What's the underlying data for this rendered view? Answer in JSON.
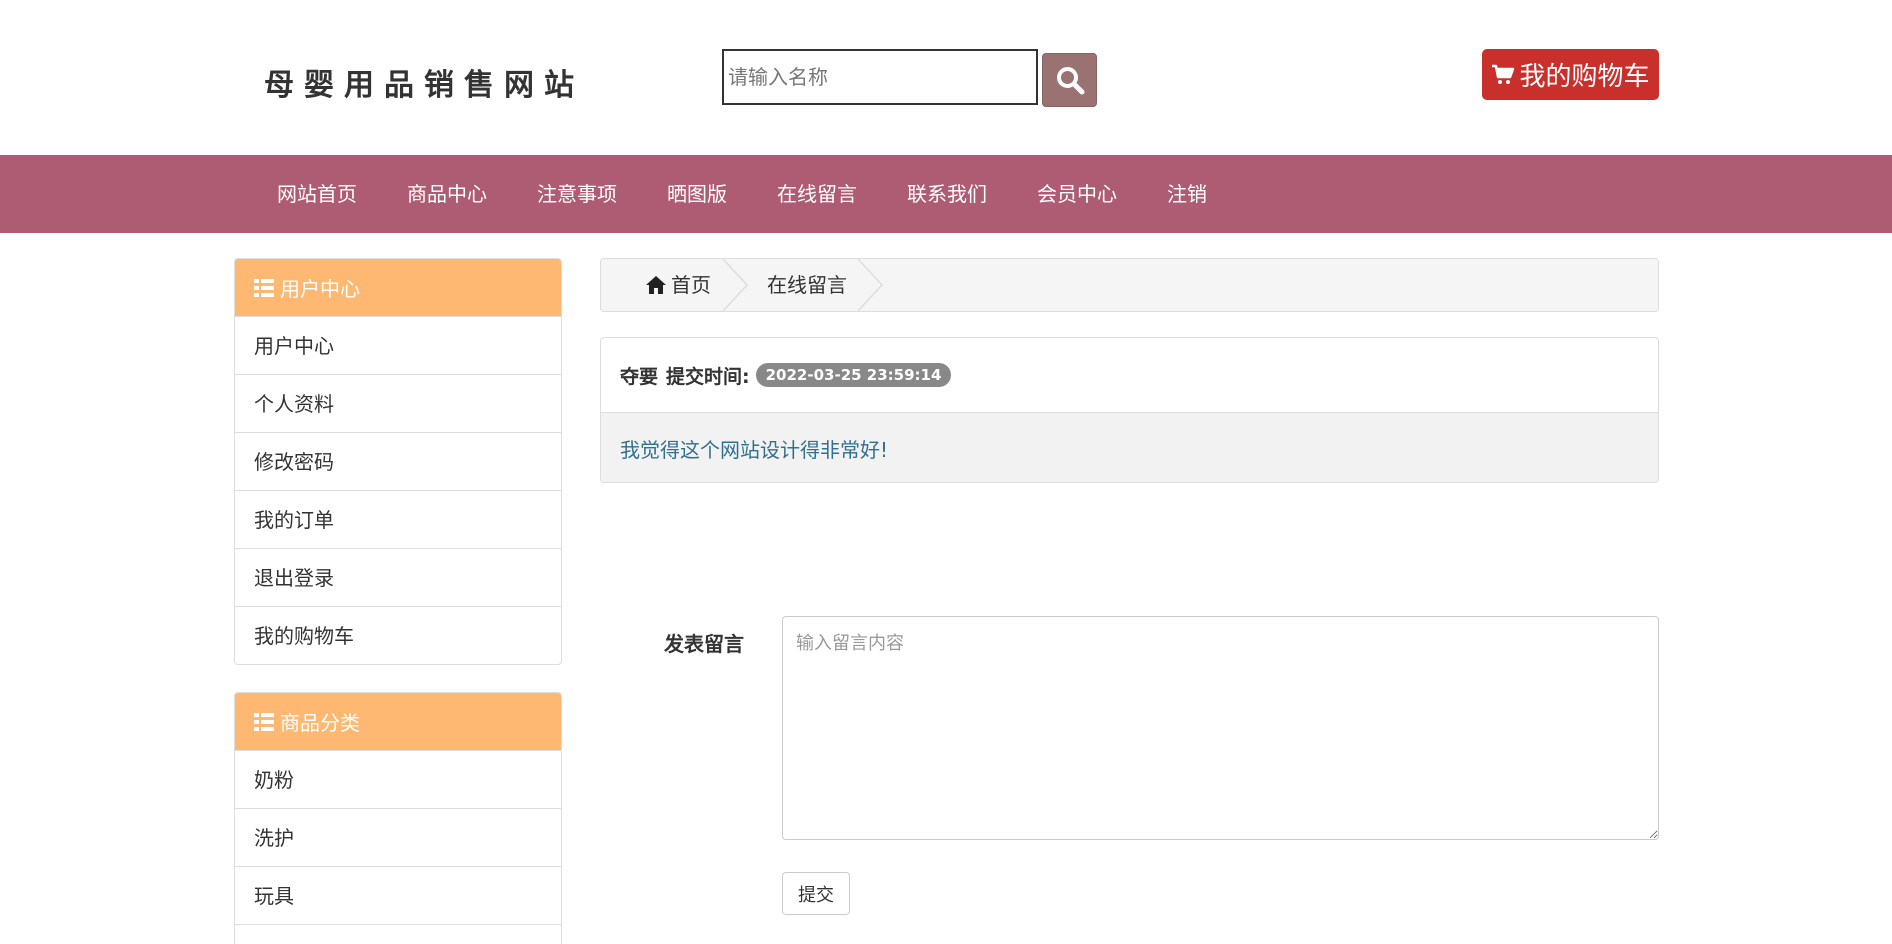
{
  "header": {
    "logo": "母婴用品销售网站",
    "search_placeholder": "请输入名称",
    "search_icon": "search-icon",
    "cart_label": "我的购物车",
    "cart_icon": "shopping-cart-icon"
  },
  "nav": {
    "items": [
      {
        "label": "网站首页"
      },
      {
        "label": "商品中心"
      },
      {
        "label": "注意事项"
      },
      {
        "label": "晒图版"
      },
      {
        "label": "在线留言"
      },
      {
        "label": "联系我们"
      },
      {
        "label": "会员中心"
      },
      {
        "label": "注销"
      }
    ]
  },
  "sidebar": {
    "user_center": {
      "title": "用户中心",
      "icon": "list-icon",
      "items": [
        {
          "label": "用户中心"
        },
        {
          "label": "个人资料"
        },
        {
          "label": "修改密码"
        },
        {
          "label": "我的订单"
        },
        {
          "label": "退出登录"
        },
        {
          "label": "我的购物车"
        }
      ]
    },
    "categories": {
      "title": "商品分类",
      "icon": "list-icon",
      "items": [
        {
          "label": "奶粉"
        },
        {
          "label": "洗护"
        },
        {
          "label": "玩具"
        }
      ]
    }
  },
  "breadcrumb": {
    "home_label": "首页",
    "home_icon": "home-icon",
    "current_label": "在线留言"
  },
  "message": {
    "author": "夺要",
    "time_label": "提交时间:",
    "time": "2022-03-25 23:59:14",
    "content": "我觉得这个网站设计得非常好!"
  },
  "form": {
    "label": "发表留言",
    "placeholder": "输入留言内容",
    "submit_label": "提交"
  },
  "colors": {
    "nav_bg": "#ad5c73",
    "panel_head": "#ffb871",
    "cart_btn": "#c9302c",
    "search_btn": "#9a7272",
    "message_text": "#31708f"
  }
}
